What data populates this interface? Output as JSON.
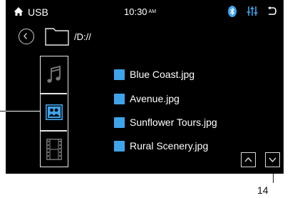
{
  "status_bar": {
    "source": "USB",
    "time": "10:30",
    "ampm": "AM",
    "icons": [
      "home-icon",
      "bluetooth-icon",
      "equalizer-icon",
      "back-arrow-icon"
    ],
    "accent_color": "#3fa3ea"
  },
  "path_bar": {
    "path": "/D://",
    "icons": [
      "circle-back-icon",
      "folder-icon"
    ]
  },
  "media_types": [
    {
      "name": "music",
      "icon": "music-note-icon",
      "selected": false
    },
    {
      "name": "photo",
      "icon": "photo-icon",
      "selected": true
    },
    {
      "name": "video",
      "icon": "film-icon",
      "selected": false
    }
  ],
  "files": [
    {
      "name": " Blue Coast.jpg",
      "icon": "image-file-icon"
    },
    {
      "name": "Avenue.jpg",
      "icon": "image-file-icon"
    },
    {
      "name": "Sunflower Tours.jpg",
      "icon": "image-file-icon"
    },
    {
      "name": "Rural Scenery.jpg",
      "icon": "image-file-icon"
    }
  ],
  "scroll": {
    "up_icon": "chevron-up-icon",
    "down_icon": "chevron-down-icon"
  },
  "callout": {
    "label": "14"
  }
}
